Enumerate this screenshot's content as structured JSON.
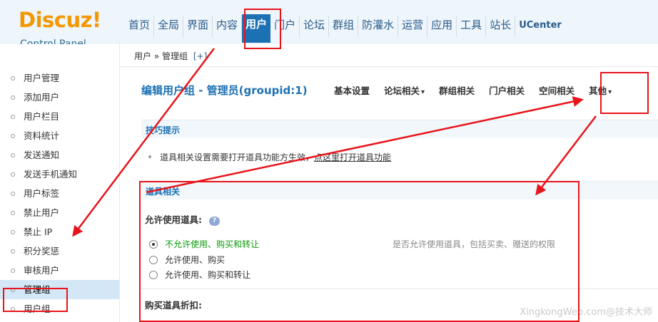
{
  "logo": {
    "main": "Discuz!",
    "sub": "Control Panel"
  },
  "nav": [
    {
      "label": "首页"
    },
    {
      "label": "全局"
    },
    {
      "label": "界面"
    },
    {
      "label": "内容"
    },
    {
      "label": "用户"
    },
    {
      "label": "门户"
    },
    {
      "label": "论坛"
    },
    {
      "label": "群组"
    },
    {
      "label": "防灌水"
    },
    {
      "label": "运营"
    },
    {
      "label": "应用"
    },
    {
      "label": "工具"
    },
    {
      "label": "站长"
    },
    {
      "label": "UCenter"
    }
  ],
  "breadcrumb": {
    "root": "用户",
    "sep": "»",
    "current": "管理组",
    "plus": "[+]"
  },
  "sidebar": {
    "items": [
      {
        "label": "用户管理"
      },
      {
        "label": "添加用户"
      },
      {
        "label": "用户栏目"
      },
      {
        "label": "资料统计"
      },
      {
        "label": "发送通知"
      },
      {
        "label": "发送手机通知"
      },
      {
        "label": "用户标签"
      },
      {
        "label": "禁止用户"
      },
      {
        "label": "禁止 IP"
      },
      {
        "label": "积分奖惩"
      },
      {
        "label": "审核用户"
      },
      {
        "label": "管理组"
      },
      {
        "label": "用户组"
      }
    ]
  },
  "main": {
    "title": "编辑用户组 - 管理员(groupid:1)",
    "tabs": [
      {
        "label": "基本设置"
      },
      {
        "label": "论坛相关"
      },
      {
        "label": "群组相关"
      },
      {
        "label": "门户相关"
      },
      {
        "label": "空间相关"
      },
      {
        "label": "其他"
      }
    ],
    "caret": "▾",
    "tip_title": "技巧提示",
    "tip_text": "道具相关设置需要打开道具功能方生效，",
    "tip_link": "点这里打开道具功能",
    "section_title": "道具相关",
    "allow_label": "允许使用道具:",
    "help": "?",
    "options": [
      {
        "label": "不允许使用、购买和转让"
      },
      {
        "label": "允许使用、购买"
      },
      {
        "label": "允许使用、购买和转让"
      }
    ],
    "option_desc": "是否允许使用道具，包括买卖、赠送的权限",
    "discount_label": "购买道具折扣:"
  },
  "watermark": "XingkongWeb.com@技术大师",
  "annotation_color": "#e8141b"
}
